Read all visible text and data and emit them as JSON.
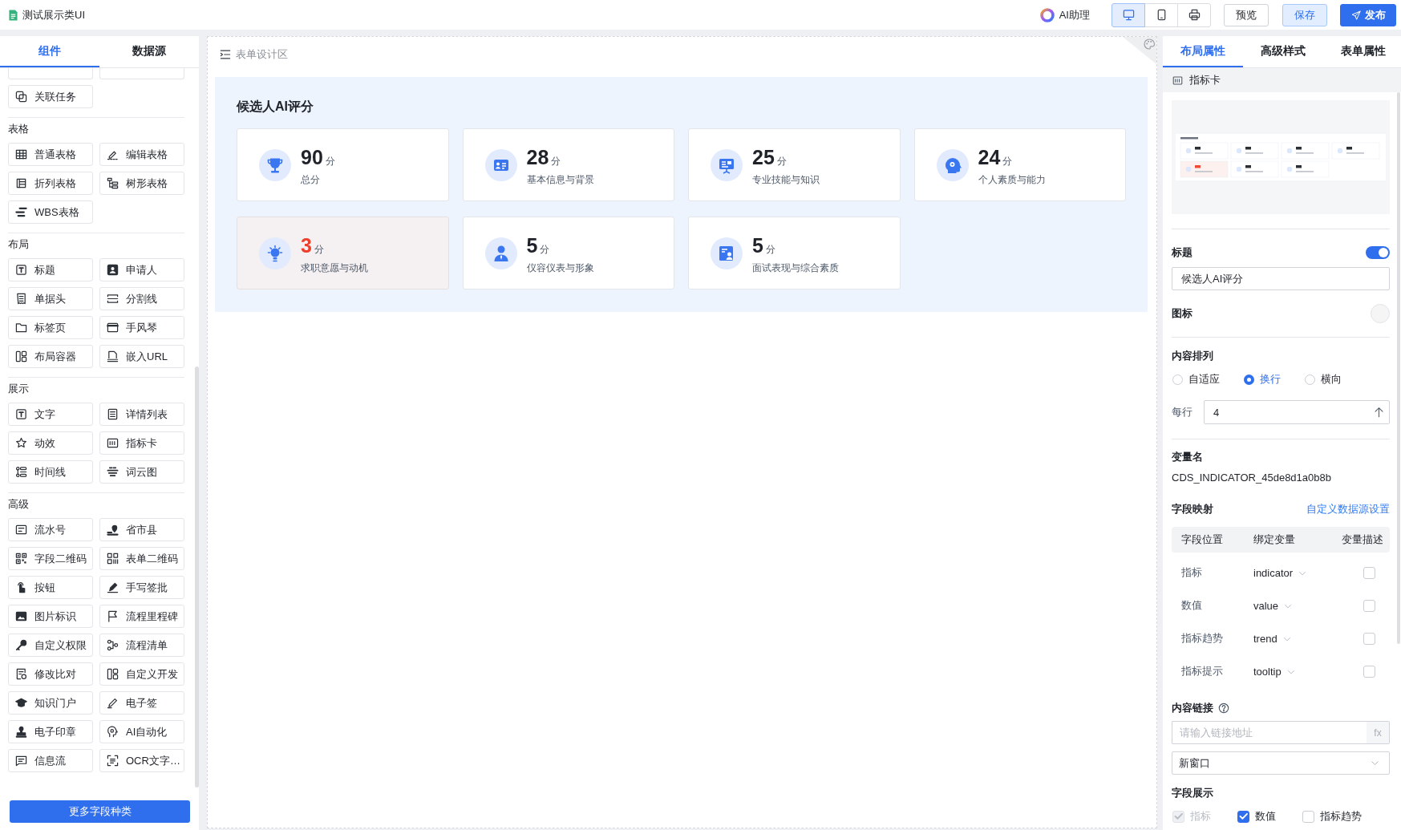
{
  "app_bar": {
    "title": "测试展示类UI",
    "assistant": "AI助理",
    "devices": [
      {
        "selected": true
      },
      {
        "selected": false
      },
      {
        "selected": false
      }
    ],
    "buttons": [
      {
        "label": "预览",
        "kind": "default"
      },
      {
        "label": "保存",
        "kind": "light"
      },
      {
        "label": "发布",
        "kind": "primary"
      }
    ]
  },
  "left_panel": {
    "tabs": [
      {
        "label": "组件",
        "selected": true
      },
      {
        "label": "数据源",
        "selected": false
      }
    ],
    "sections": [
      {
        "items": [
          "关联任务"
        ]
      },
      {
        "title": "表格",
        "items": [
          "普通表格",
          "编辑表格",
          "折列表格",
          "树形表格",
          "WBS表格"
        ]
      },
      {
        "title": "布局",
        "items": [
          "标题",
          "申请人",
          "单据头",
          "分割线",
          "标签页",
          "手风琴",
          "布局容器",
          "嵌入URL"
        ]
      },
      {
        "title": "展示",
        "items": [
          "文字",
          "详情列表",
          "动效",
          "指标卡",
          "时间线",
          "词云图"
        ]
      },
      {
        "title": "高级",
        "items": [
          "流水号",
          "省市县",
          "字段二维码",
          "表单二维码",
          "按钮",
          "手写签批",
          "图片标识",
          "流程里程碑",
          "自定义权限",
          "流程清单",
          "修改比对",
          "自定义开发",
          "知识门户",
          "电子签",
          "电子印章",
          "AI自动化",
          "信息流",
          "OCR文字…"
        ]
      }
    ],
    "more_button": "更多字段种类"
  },
  "canvas": {
    "header": "表单设计区",
    "widget": {
      "title": "候选人AI评分",
      "cards": [
        {
          "value": "90",
          "unit": "分",
          "label": "总分",
          "warning": false
        },
        {
          "value": "28",
          "unit": "分",
          "label": "基本信息与背景",
          "warning": false
        },
        {
          "value": "25",
          "unit": "分",
          "label": "专业技能与知识",
          "warning": false
        },
        {
          "value": "24",
          "unit": "分",
          "label": "个人素质与能力",
          "warning": false
        },
        {
          "value": "3",
          "unit": "分",
          "label": "求职意愿与动机",
          "warning": true
        },
        {
          "value": "5",
          "unit": "分",
          "label": "仪容仪表与形象",
          "warning": false
        },
        {
          "value": "5",
          "unit": "分",
          "label": "面试表现与综合素质",
          "warning": false
        }
      ]
    }
  },
  "right_panel": {
    "tabs": [
      {
        "label": "布局属性",
        "selected": true
      },
      {
        "label": "高级样式",
        "selected": false
      },
      {
        "label": "表单属性",
        "selected": false
      }
    ],
    "component": "指标卡",
    "title_field": {
      "label": "标题",
      "on": true,
      "value": "候选人AI评分"
    },
    "icon_field": {
      "label": "图标"
    },
    "arrangement": {
      "label": "内容排列",
      "options": [
        {
          "label": "自适应",
          "selected": false
        },
        {
          "label": "换行",
          "selected": true
        },
        {
          "label": "横向",
          "selected": false
        }
      ]
    },
    "per_row": {
      "label": "每行",
      "value": "4"
    },
    "variable": {
      "label": "变量名",
      "value": "CDS_INDICATOR_45de8d1a0b8b"
    },
    "mapping": {
      "label": "字段映射",
      "link": "自定义数据源设置",
      "columns": [
        "字段位置",
        "绑定变量",
        "变量描述"
      ],
      "rows": [
        {
          "field": "指标",
          "variable": "indicator",
          "checked": false
        },
        {
          "field": "数值",
          "variable": "value",
          "checked": false
        },
        {
          "field": "指标趋势",
          "variable": "trend",
          "checked": false
        },
        {
          "field": "指标提示",
          "variable": "tooltip",
          "checked": false
        }
      ]
    },
    "content_link": {
      "label": "内容链接",
      "placeholder": "请输入链接地址",
      "suffix": "fx",
      "target": "新窗口"
    },
    "field_display": {
      "label": "字段展示",
      "options": [
        {
          "label": "指标",
          "checked": true,
          "disabled": true
        },
        {
          "label": "数值",
          "checked": true,
          "disabled": false
        },
        {
          "label": "指标趋势",
          "checked": false,
          "disabled": false
        }
      ]
    }
  }
}
